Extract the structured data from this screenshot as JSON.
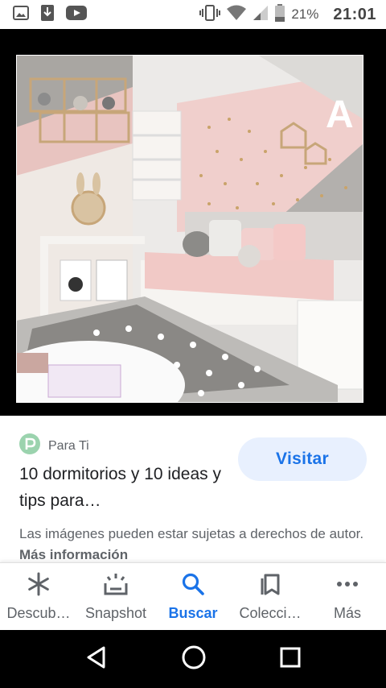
{
  "status_bar": {
    "battery_percent": "21%",
    "time": "21:01"
  },
  "result": {
    "source_name": "Para Ti",
    "title": "10 dormitorios y 10 ideas y tips para…",
    "visit_label": "Visitar",
    "copyright_text": "Las imágenes pueden estar sujetas a derechos de autor.",
    "more_info_label": "Más información"
  },
  "bottom_nav": {
    "items": [
      {
        "label": "Descub…",
        "icon": "asterisk-icon"
      },
      {
        "label": "Snapshot",
        "icon": "snapshot-icon"
      },
      {
        "label": "Buscar",
        "icon": "search-icon"
      },
      {
        "label": "Colecci…",
        "icon": "collections-icon"
      },
      {
        "label": "Más",
        "icon": "more-icon"
      }
    ],
    "active_index": 2
  },
  "colors": {
    "accent": "#1a73e8",
    "visit_bg": "#e8f0fe",
    "source_logo": "#9bd3ae"
  }
}
